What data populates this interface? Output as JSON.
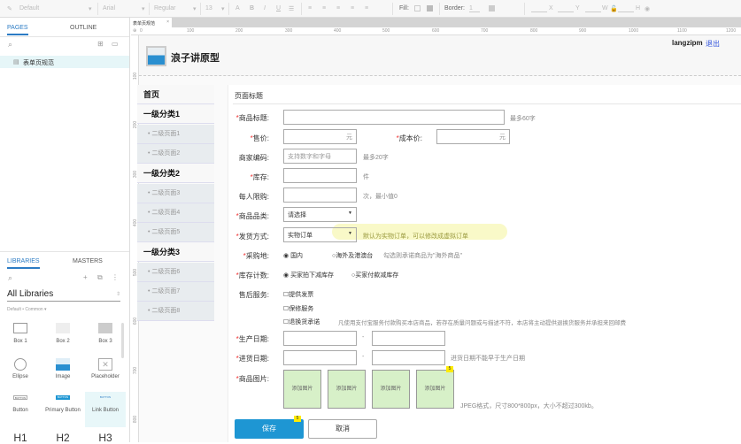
{
  "toolbar": {
    "style": "Default",
    "font": "Arial",
    "weight": "Regular",
    "size": "13",
    "fill_label": "Fill:",
    "border_label": "Border:",
    "border_value": "1",
    "x_label": "X",
    "y_label": "Y",
    "w_label": "W",
    "h_label": "H"
  },
  "left_panel": {
    "tabs": [
      "PAGES",
      "OUTLINE"
    ],
    "pages": [
      "表单页规范"
    ],
    "lib_tabs": [
      "LIBRARIES",
      "MASTERS"
    ],
    "library_select": "All Libraries",
    "library_filter": "Default • Common ▾",
    "widgets": [
      "Box 1",
      "Box 2",
      "Box 3",
      "Ellipse",
      "Image",
      "Placeholder",
      "Button",
      "Primary Button",
      "Link Button",
      "H1",
      "H2",
      "H3"
    ],
    "button_sample": "BUTTON"
  },
  "doc_tab": "表单页规范",
  "ruler": [
    "0",
    "100",
    "200",
    "300",
    "400",
    "500",
    "600",
    "700",
    "800",
    "900",
    "1000",
    "1100",
    "1200"
  ],
  "vruler": [
    "100",
    "200",
    "300",
    "400",
    "500",
    "600",
    "700",
    "800"
  ],
  "header": {
    "brand": "浪子讲原型",
    "user": "langzipm",
    "logout": "退出"
  },
  "nav": [
    {
      "label": "首页",
      "level": 1
    },
    {
      "label": "一级分类1",
      "level": 1
    },
    {
      "label": "• 二级页面1",
      "level": 2
    },
    {
      "label": "• 二级页面2",
      "level": 2
    },
    {
      "label": "一级分类2",
      "level": 1
    },
    {
      "label": "• 二级页面3",
      "level": 2
    },
    {
      "label": "• 二级页面4",
      "level": 2
    },
    {
      "label": "• 二级页面5",
      "level": 2
    },
    {
      "label": "一级分类3",
      "level": 1
    },
    {
      "label": "• 二级页面6",
      "level": 2
    },
    {
      "label": "• 二级页面7",
      "level": 2
    },
    {
      "label": "• 二级页面8",
      "level": 2
    }
  ],
  "form": {
    "title": "页面标题",
    "required_mark": "*",
    "product_title": {
      "label": "商品标题:",
      "hint": "最多60字"
    },
    "price": {
      "label": "售价:",
      "unit": "元"
    },
    "cost": {
      "label": "成本价:",
      "unit": "元"
    },
    "sku_code": {
      "label": "商家编码:",
      "placeholder": "支持数字和字母",
      "hint": "最多20字"
    },
    "stock": {
      "label": "库存:",
      "hint": "件"
    },
    "limit": {
      "label": "每人限购:",
      "hint": "次，最小值0"
    },
    "category": {
      "label": "商品品类:",
      "value": "请选择"
    },
    "shipping": {
      "label": "发货方式:",
      "value": "实物订单",
      "hint": "默认为实物订单，可以修改成虚拟订单"
    },
    "origin": {
      "label": "采购地:",
      "options": [
        "国内",
        "海外及港澳台"
      ],
      "hint": "勾选则承诺商品为\"海外商品\""
    },
    "stock_count": {
      "label": "库存计数:",
      "options": [
        "买家拍下减库存",
        "买家付款减库存"
      ]
    },
    "after_sales": {
      "label": "售后服务:",
      "options": [
        "提供发票",
        "保修服务",
        "退换货承诺"
      ],
      "hint": "凡使用支付宝服务付款购买本店商品，若存在质量问题或与描述不符，本店将主动提供退换货服务并承担来回邮费"
    },
    "production_date": {
      "label": "生产日期:",
      "sep": "-"
    },
    "purchase_date": {
      "label": "进货日期:",
      "sep": "-",
      "hint": "进货日期不能早于生产日期"
    },
    "images": {
      "label": "商品图片:",
      "slot": "添加图片",
      "hint": "JPEG格式，尺寸800*800px，大小不超过300kb。"
    },
    "save": "保存",
    "cancel": "取消",
    "note_badge": "5"
  },
  "colors": {
    "accent": "#2b7bc4",
    "primary_button": "#1e96d3",
    "required": "#e33333",
    "image_slot": "#d7f0c8",
    "highlight": "#f9f9c8"
  }
}
